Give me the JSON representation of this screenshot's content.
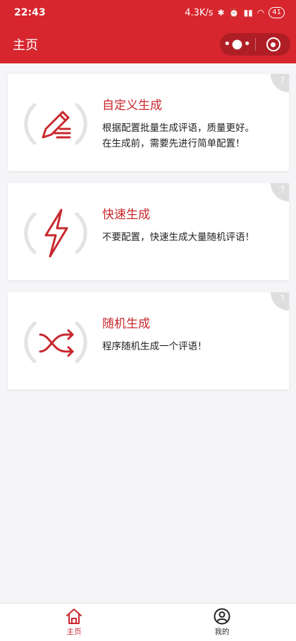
{
  "status_bar": {
    "time": "22:43",
    "speed": "4.3K/s",
    "battery": "41"
  },
  "nav": {
    "title": "主页",
    "more_icon": "more-dots-icon",
    "close_icon": "target-icon"
  },
  "cards": [
    {
      "title": "自定义生成",
      "desc_line1": "根据配置批量生成评语，质量更好。",
      "desc_line2": "在生成前，需要先进行简单配置！",
      "icon": "pencil-icon",
      "help": "?"
    },
    {
      "title": "快速生成",
      "desc_line1": "不要配置，快速生成大量随机评语！",
      "icon": "lightning-icon",
      "help": "?"
    },
    {
      "title": "随机生成",
      "desc_line1": "程序随机生成一个评语！",
      "icon": "shuffle-icon",
      "help": "?"
    }
  ],
  "tabbar": [
    {
      "label": "主页",
      "icon": "home-icon",
      "active": true
    },
    {
      "label": "我的",
      "icon": "user-icon",
      "active": false
    }
  ],
  "colors": {
    "brand": "#d7262e",
    "accent": "#c8282e"
  }
}
